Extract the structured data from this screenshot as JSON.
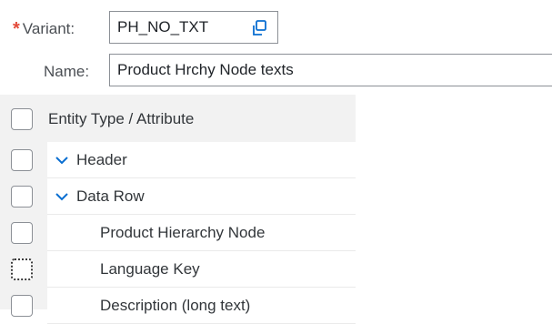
{
  "variant": {
    "required_marker": "*",
    "label": "Variant:",
    "value": "PH_NO_TXT",
    "icon": "copy-icon"
  },
  "name": {
    "label": "Name:",
    "value": "Product Hrchy Node texts"
  },
  "table": {
    "header": "Entity Type / Attribute",
    "rows": [
      {
        "label": "Header",
        "expandable": true,
        "expanded": true
      },
      {
        "label": "Data Row",
        "expandable": true,
        "expanded": true
      },
      {
        "label": "Product Hierarchy Node",
        "expandable": false
      },
      {
        "label": "Language Key",
        "expandable": false,
        "focused": true
      },
      {
        "label": "Description (long text)",
        "expandable": false
      }
    ]
  },
  "colors": {
    "accent": "#0a6ed1",
    "required": "#e34b3a",
    "table_bg": "#f2f2f2",
    "border": "#8c9096"
  }
}
